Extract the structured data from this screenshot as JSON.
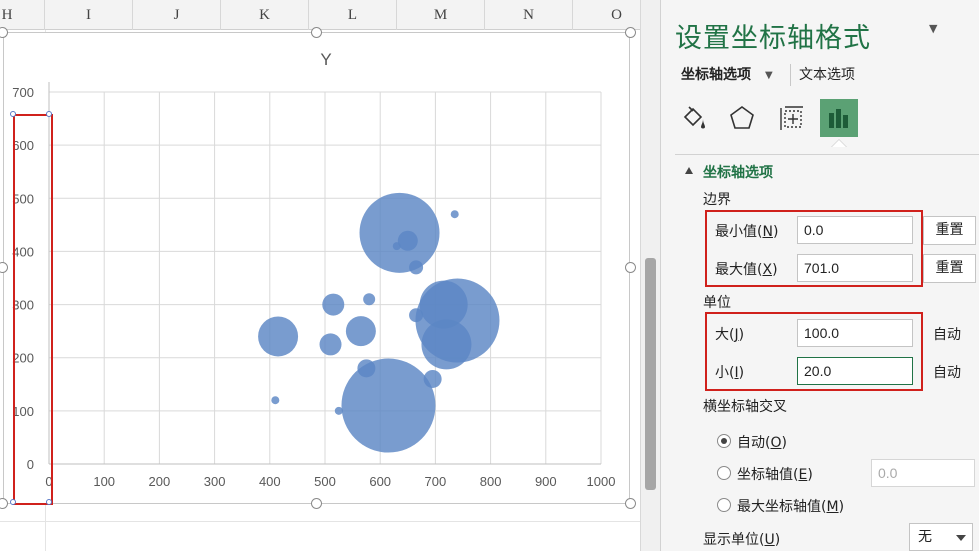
{
  "sheet": {
    "columns": [
      "H",
      "I",
      "J",
      "K",
      "L",
      "M",
      "N",
      "O"
    ]
  },
  "chart_data": {
    "type": "scatter",
    "title": "Y",
    "xlabel": "",
    "ylabel": "",
    "xlim": [
      0,
      1000
    ],
    "ylim": [
      0,
      701
    ],
    "x_ticks": [
      "0",
      "100",
      "200",
      "300",
      "400",
      "500",
      "600",
      "700",
      "800",
      "900",
      "1000"
    ],
    "y_ticks": [
      "0",
      "100",
      "200",
      "300",
      "400",
      "500",
      "600",
      "700"
    ],
    "grid": true,
    "bubble_color": "#5b86c5",
    "bubbles": [
      {
        "x": 410,
        "y": 120,
        "r": 4
      },
      {
        "x": 415,
        "y": 240,
        "r": 20
      },
      {
        "x": 510,
        "y": 225,
        "r": 11
      },
      {
        "x": 515,
        "y": 300,
        "r": 11
      },
      {
        "x": 525,
        "y": 100,
        "r": 4
      },
      {
        "x": 565,
        "y": 250,
        "r": 15
      },
      {
        "x": 575,
        "y": 180,
        "r": 9
      },
      {
        "x": 580,
        "y": 310,
        "r": 6
      },
      {
        "x": 615,
        "y": 110,
        "r": 47
      },
      {
        "x": 630,
        "y": 410,
        "r": 4
      },
      {
        "x": 635,
        "y": 435,
        "r": 40
      },
      {
        "x": 650,
        "y": 420,
        "r": 10
      },
      {
        "x": 665,
        "y": 370,
        "r": 7
      },
      {
        "x": 665,
        "y": 280,
        "r": 7
      },
      {
        "x": 695,
        "y": 160,
        "r": 9
      },
      {
        "x": 715,
        "y": 300,
        "r": 24
      },
      {
        "x": 720,
        "y": 225,
        "r": 25
      },
      {
        "x": 735,
        "y": 470,
        "r": 4
      },
      {
        "x": 740,
        "y": 270,
        "r": 42
      }
    ]
  },
  "panel": {
    "title": "设置坐标轴格式",
    "tabs": {
      "active": "坐标轴选项",
      "other": "文本选项"
    },
    "icons": [
      "fill-icon",
      "pentagon-icon",
      "size-icon",
      "bar-chart-icon"
    ],
    "section": "坐标轴选项",
    "bounds": {
      "label": "边界",
      "min_label": "最小值(",
      "min_key": "N",
      "min_value": "0.0",
      "max_label": "最大值(",
      "max_key": "X",
      "max_value": "701.0",
      "reset": "重置"
    },
    "units": {
      "label": "单位",
      "major_label": "大(",
      "major_key": "J",
      "major_value": "100.0",
      "minor_label": "小(",
      "minor_key": "I",
      "minor_value": "20.0",
      "auto": "自动"
    },
    "cross": {
      "label": "横坐标轴交叉",
      "opt_auto": "自动(",
      "opt_auto_key": "O",
      "opt_value": "坐标轴值(",
      "opt_value_key": "E",
      "opt_value_field": "0.0",
      "opt_max": "最大坐标轴值(",
      "opt_max_key": "M"
    },
    "display_units": {
      "label": "显示单位(",
      "key": "U",
      "value": "无"
    }
  }
}
